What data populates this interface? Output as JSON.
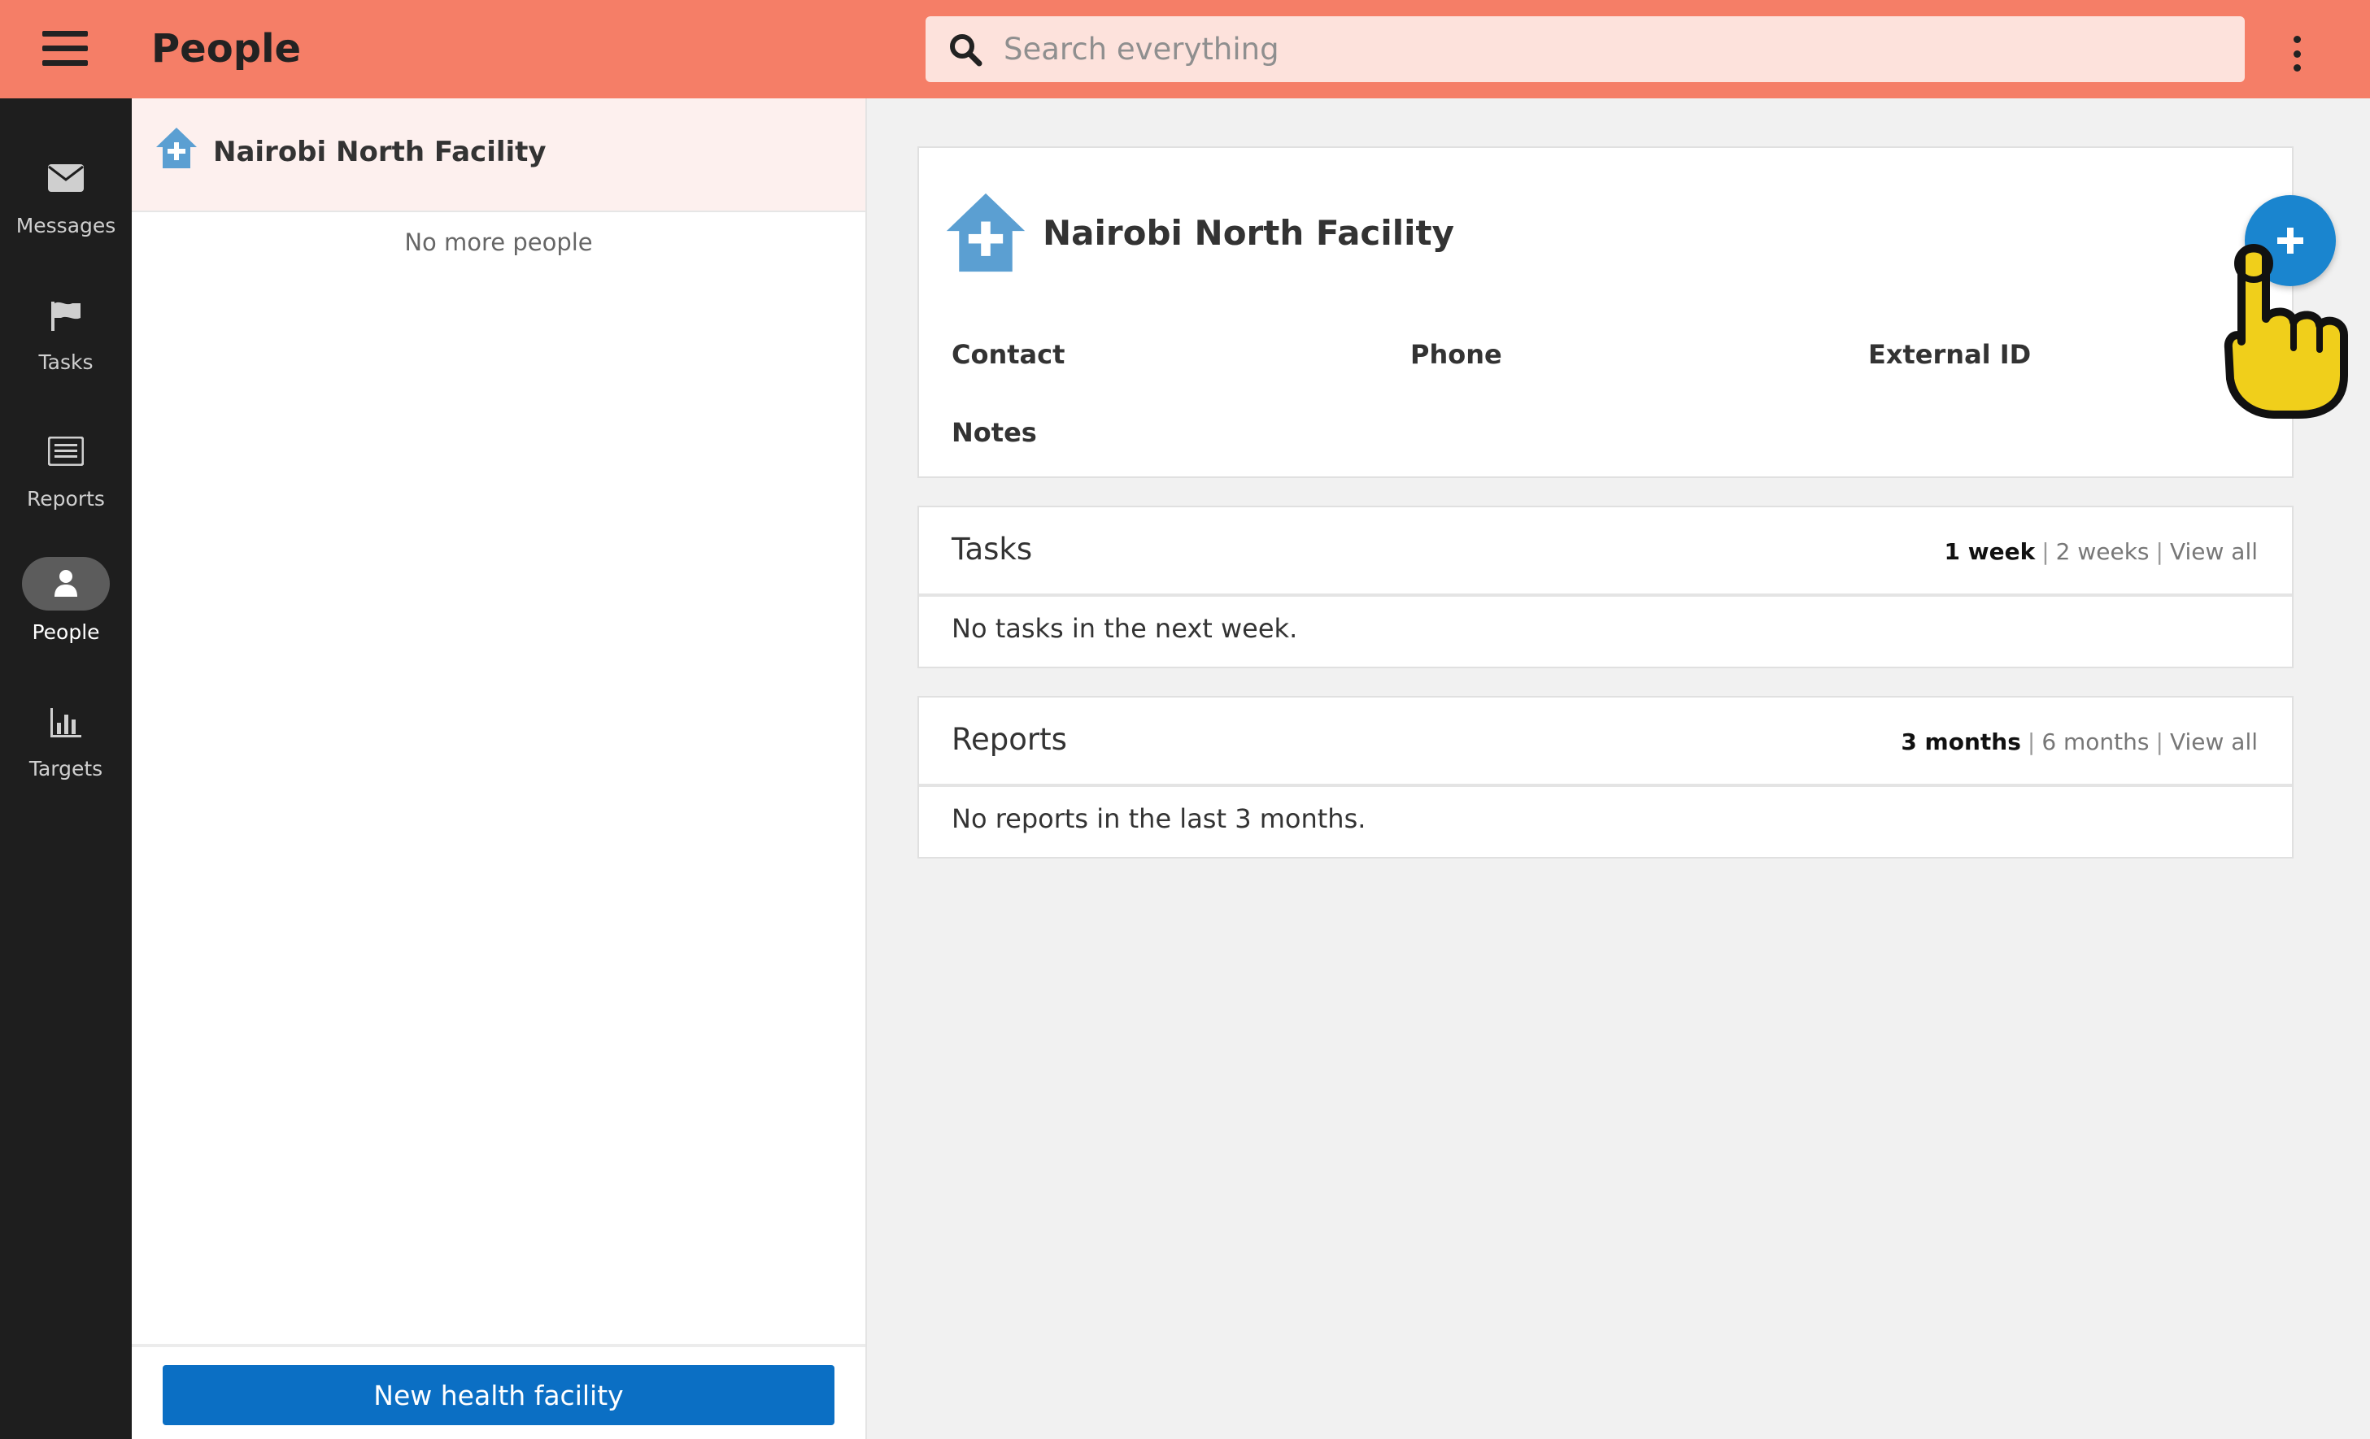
{
  "header": {
    "title": "People",
    "search_placeholder": "Search everything",
    "search_value": "",
    "accent_color": "#f57e67"
  },
  "leftnav": {
    "items": [
      {
        "label": "Messages",
        "icon": "envelope-icon",
        "active": false
      },
      {
        "label": "Tasks",
        "icon": "flag-icon",
        "active": false
      },
      {
        "label": "Reports",
        "icon": "list-icon",
        "active": false
      },
      {
        "label": "People",
        "icon": "person-icon",
        "active": true
      },
      {
        "label": "Targets",
        "icon": "bar-chart-icon",
        "active": false
      }
    ]
  },
  "list": {
    "selected_item": "Nairobi North Facility",
    "empty_message": "No more people",
    "new_button": "New health facility",
    "button_color": "#0b6fc4"
  },
  "detail": {
    "title": "Nairobi North Facility",
    "fields": {
      "contact": "Contact",
      "phone": "Phone",
      "external_id": "External ID",
      "notes": "Notes"
    },
    "tasks": {
      "title": "Tasks",
      "filters": [
        "1 week",
        "2 weeks",
        "View all"
      ],
      "active_filter": "1 week",
      "empty": "No tasks in the next week."
    },
    "reports": {
      "title": "Reports",
      "filters": [
        "3 months",
        "6 months",
        "View all"
      ],
      "active_filter": "3 months",
      "empty": "No reports in the last 3 months."
    }
  },
  "fab": {
    "icon": "plus-icon",
    "color": "#1a85cf"
  },
  "overlay": {
    "icon": "hand-pointer-icon"
  }
}
